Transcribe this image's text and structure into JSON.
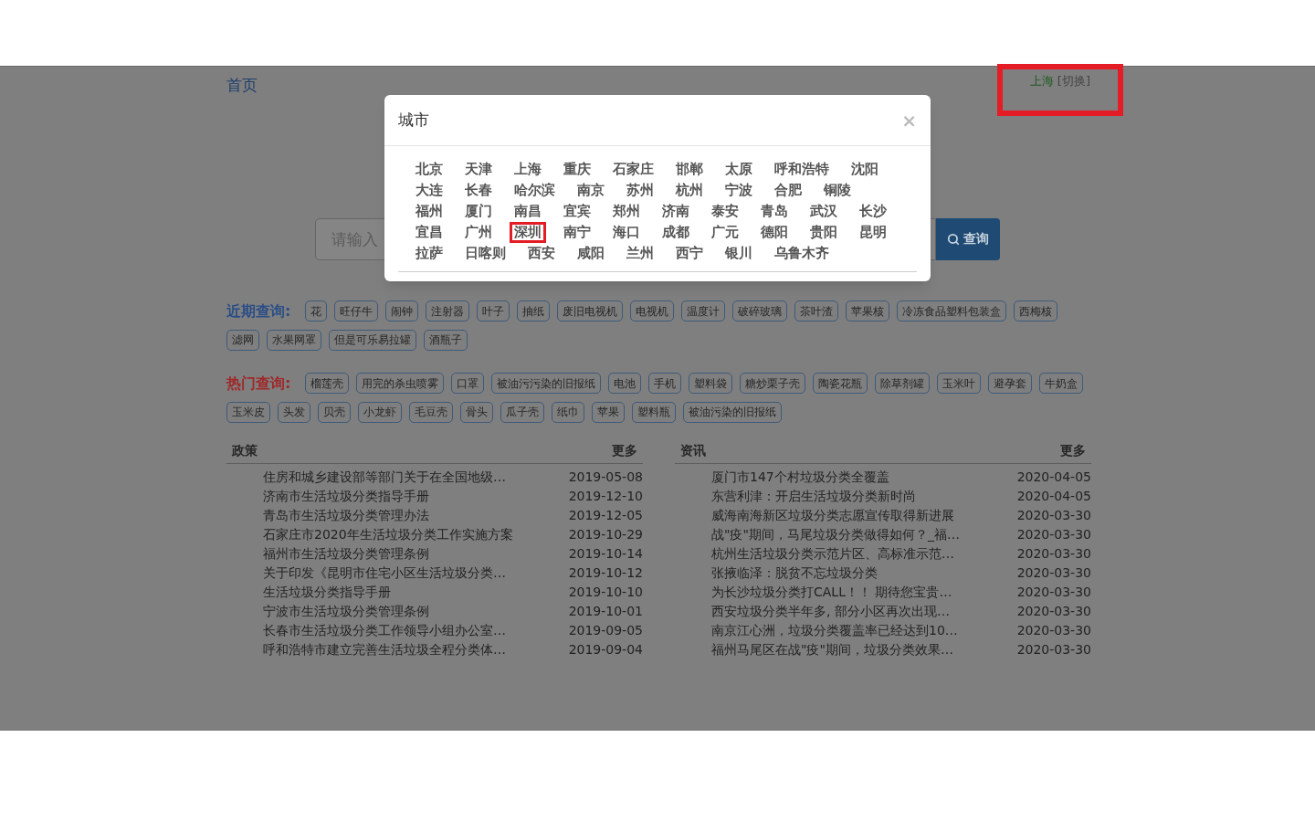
{
  "header": {
    "home_link": "首页",
    "location": {
      "city": "上海",
      "switch": "[切换]",
      "highlighted": true
    }
  },
  "search": {
    "placeholder": "请输入",
    "button": "查询"
  },
  "recent": {
    "label": "近期查询:",
    "tags": [
      "花",
      "旺仔牛",
      "闹钟",
      "注射器",
      "叶子",
      "抽纸",
      "废旧电视机",
      "电视机",
      "温度计",
      "破碎玻璃",
      "茶叶渣",
      "苹果核",
      "冷冻食品塑料包装盒",
      "西梅核",
      "滤网",
      "水果网罩",
      "但是可乐易拉罐",
      "酒瓶子"
    ]
  },
  "hot": {
    "label": "热门查询:",
    "tags": [
      "榴莲壳",
      "用完的杀虫喷雾",
      "口罩",
      "被油污污染的旧报纸",
      "电池",
      "手机",
      "塑料袋",
      "糖炒栗子壳",
      "陶瓷花瓶",
      "除草剂罐",
      "玉米叶",
      "避孕套",
      "牛奶盒",
      "玉米皮",
      "头发",
      "贝壳",
      "小龙虾",
      "毛豆壳",
      "骨头",
      "瓜子壳",
      "纸巾",
      "苹果",
      "塑料瓶",
      "被油污染的旧报纸"
    ]
  },
  "panels": [
    {
      "title": "政策",
      "more": "更多",
      "items": [
        {
          "title": "住房和城乡建设部等部门关于在全国地级…",
          "date": "2019-05-08"
        },
        {
          "title": "济南市生活垃圾分类指导手册",
          "date": "2019-12-10"
        },
        {
          "title": "青岛市生活垃圾分类管理办法",
          "date": "2019-12-05"
        },
        {
          "title": "石家庄市2020年生活垃圾分类工作实施方案",
          "date": "2019-10-29"
        },
        {
          "title": "福州市生活垃圾分类管理条例",
          "date": "2019-10-14"
        },
        {
          "title": "关于印发《昆明市住宅小区生活垃圾分类…",
          "date": "2019-10-12"
        },
        {
          "title": "生活垃圾分类指导手册",
          "date": "2019-10-10"
        },
        {
          "title": "宁波市生活垃圾分类管理条例",
          "date": "2019-10-01"
        },
        {
          "title": "长春市生活垃圾分类工作领导小组办公室…",
          "date": "2019-09-05"
        },
        {
          "title": "呼和浩特市建立完善生活垃圾全程分类体…",
          "date": "2019-09-04"
        }
      ]
    },
    {
      "title": "资讯",
      "more": "更多",
      "items": [
        {
          "title": "厦门市147个村垃圾分类全覆盖",
          "date": "2020-04-05"
        },
        {
          "title": "东营利津：开启生活垃圾分类新时尚",
          "date": "2020-04-05"
        },
        {
          "title": "威海南海新区垃圾分类志愿宣传取得新进展",
          "date": "2020-03-30"
        },
        {
          "title": "战\"疫\"期间，马尾垃圾分类做得如何？_福…",
          "date": "2020-03-30"
        },
        {
          "title": "杭州生活垃圾分类示范片区、高标准示范…",
          "date": "2020-03-30"
        },
        {
          "title": "张掖临泽：脱贫不忘垃圾分类",
          "date": "2020-03-30"
        },
        {
          "title": "为长沙垃圾分类打CALL！！ 期待您宝贵…",
          "date": "2020-03-30"
        },
        {
          "title": "西安垃圾分类半年多, 部分小区再次出现…",
          "date": "2020-03-30"
        },
        {
          "title": "南京江心洲，垃圾分类覆盖率已经达到10…",
          "date": "2020-03-30"
        },
        {
          "title": "福州马尾区在战\"疫\"期间，垃圾分类效果…",
          "date": "2020-03-30"
        }
      ]
    }
  ],
  "modal": {
    "title": "城市",
    "close": "×",
    "cities": [
      {
        "name": "北京",
        "highlighted": false
      },
      {
        "name": "天津",
        "highlighted": false
      },
      {
        "name": "上海",
        "highlighted": false
      },
      {
        "name": "重庆",
        "highlighted": false
      },
      {
        "name": "石家庄",
        "highlighted": false
      },
      {
        "name": "邯郸",
        "highlighted": false
      },
      {
        "name": "太原",
        "highlighted": false
      },
      {
        "name": "呼和浩特",
        "highlighted": false
      },
      {
        "name": "沈阳",
        "highlighted": false
      },
      {
        "name": "大连",
        "highlighted": false
      },
      {
        "name": "长春",
        "highlighted": false
      },
      {
        "name": "哈尔滨",
        "highlighted": false
      },
      {
        "name": "南京",
        "highlighted": false
      },
      {
        "name": "苏州",
        "highlighted": false
      },
      {
        "name": "杭州",
        "highlighted": false
      },
      {
        "name": "宁波",
        "highlighted": false
      },
      {
        "name": "合肥",
        "highlighted": false
      },
      {
        "name": "铜陵",
        "highlighted": false
      },
      {
        "name": "福州",
        "highlighted": false
      },
      {
        "name": "厦门",
        "highlighted": false
      },
      {
        "name": "南昌",
        "highlighted": false
      },
      {
        "name": "宜宾",
        "highlighted": false
      },
      {
        "name": "郑州",
        "highlighted": false
      },
      {
        "name": "济南",
        "highlighted": false
      },
      {
        "name": "泰安",
        "highlighted": false
      },
      {
        "name": "青岛",
        "highlighted": false
      },
      {
        "name": "武汉",
        "highlighted": false
      },
      {
        "name": "长沙",
        "highlighted": false
      },
      {
        "name": "宜昌",
        "highlighted": false
      },
      {
        "name": "广州",
        "highlighted": false
      },
      {
        "name": "深圳",
        "highlighted": true
      },
      {
        "name": "南宁",
        "highlighted": false
      },
      {
        "name": "海口",
        "highlighted": false
      },
      {
        "name": "成都",
        "highlighted": false
      },
      {
        "name": "广元",
        "highlighted": false
      },
      {
        "name": "德阳",
        "highlighted": false
      },
      {
        "name": "贵阳",
        "highlighted": false
      },
      {
        "name": "昆明",
        "highlighted": false
      },
      {
        "name": "拉萨",
        "highlighted": false
      },
      {
        "name": "日喀则",
        "highlighted": false
      },
      {
        "name": "西安",
        "highlighted": false
      },
      {
        "name": "咸阳",
        "highlighted": false
      },
      {
        "name": "兰州",
        "highlighted": false
      },
      {
        "name": "西宁",
        "highlighted": false
      },
      {
        "name": "银川",
        "highlighted": false
      },
      {
        "name": "乌鲁木齐",
        "highlighted": false
      }
    ]
  }
}
